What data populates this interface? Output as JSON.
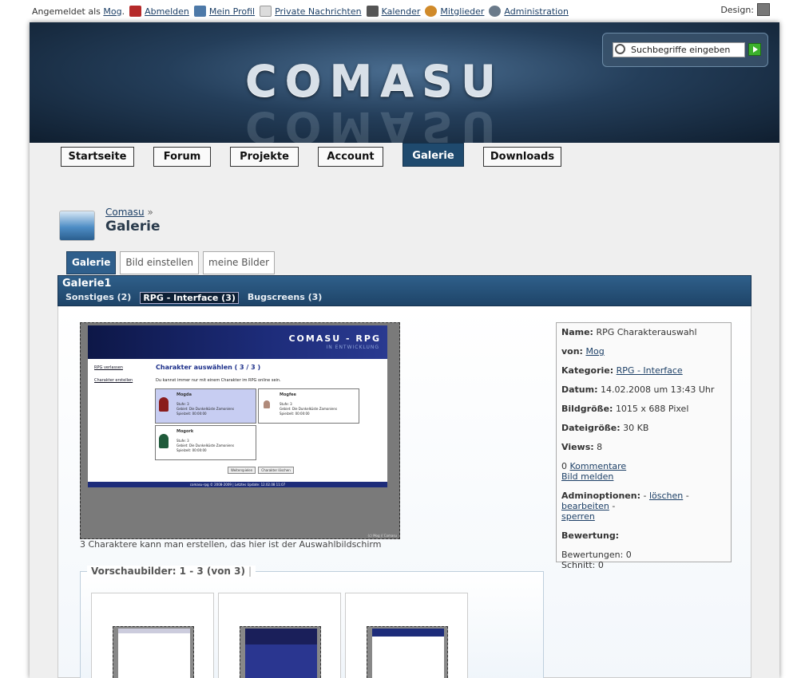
{
  "topbar": {
    "logged_prefix": "Angemeldet als",
    "user": "Mog",
    "logged_suffix": ".",
    "items": [
      {
        "label": "Abmelden",
        "icon": "logout-icon",
        "color": "#b52a2a"
      },
      {
        "label": "Mein Profil",
        "icon": "profile-card-icon",
        "color": "#4d79a8"
      },
      {
        "label": "Private Nachrichten",
        "icon": "envelope-icon",
        "color": "#c9c9c9"
      },
      {
        "label": "Kalender",
        "icon": "calendar-icon",
        "color": "#555555"
      },
      {
        "label": "Mitglieder",
        "icon": "members-icon",
        "color": "#d08a2a"
      },
      {
        "label": "Administration",
        "icon": "gear-icon",
        "color": "#6a7a8a"
      }
    ],
    "design_label": "Design:"
  },
  "header": {
    "logo": "COMASU",
    "search_placeholder": "Suchbegriffe eingeben"
  },
  "nav": [
    {
      "label": "Startseite",
      "active": false
    },
    {
      "label": "Forum",
      "active": false
    },
    {
      "label": "Projekte",
      "active": false
    },
    {
      "label": "Account",
      "active": false
    },
    {
      "label": "Galerie",
      "active": true
    },
    {
      "label": "Downloads",
      "active": false
    }
  ],
  "breadcrumb": {
    "link": "Comasu",
    "sep": "»",
    "title": "Galerie"
  },
  "tabs": [
    {
      "label": "Galerie",
      "active": true
    },
    {
      "label": "Bild einstellen",
      "active": false
    },
    {
      "label": "meine Bilder",
      "active": false
    }
  ],
  "gallery": {
    "title": "Galerie1",
    "categories": [
      {
        "label": "Sonstiges (2)",
        "selected": false
      },
      {
        "label": "RPG - Interface (3)",
        "selected": true
      },
      {
        "label": "Bugscreens (3)",
        "selected": false
      }
    ]
  },
  "screenshot": {
    "header_title": "COMASU - RPG",
    "header_sub": "IN ENTWICKLUNG",
    "side_links": [
      "RPG verlassen",
      "Charakter erstellen"
    ],
    "heading": "Charakter auswählen ( 3 / 3 )",
    "subtext": "Du kannst immer nur mit einem Charakter im RPG online sein.",
    "characters": [
      {
        "name": "Mogda",
        "stufe": "Stufe: 3",
        "gebiet": "Gebiet: Die Dunkelküste Zamoniens",
        "spielzeit": "Spielzeit: 00:00:00"
      },
      {
        "name": "Mogfee",
        "stufe": "Stufe: 3",
        "gebiet": "Gebiet: Die Dunkelküste Zamoniens",
        "spielzeit": "Spielzeit: 00:00:00"
      },
      {
        "name": "Mogork",
        "stufe": "Stufe: 3",
        "gebiet": "Gebiet: Die Dunkelküste Zamoniens",
        "spielzeit": "Spielzeit: 00:00:00"
      }
    ],
    "buttons": [
      "Weiterspielen",
      "Charakter löschen"
    ],
    "footer": "comasu-rpg © 2008-2009 | Letztes Update: 12.02.08 11:07",
    "corner": "(c) Mog // Comasu"
  },
  "caption": "3 Charaktere kann man erstellen, das hier ist der Auswahlbildschirm",
  "info": {
    "name_label": "Name:",
    "name": "RPG Charakterauswahl",
    "von_label": "von:",
    "von": "Mog",
    "kategorie_label": "Kategorie:",
    "kategorie": "RPG - Interface",
    "datum_label": "Datum:",
    "datum": "14.02.2008 um 13:43 Uhr",
    "groesse_label": "Bildgröße:",
    "groesse": "1015 x 688 Pixel",
    "datei_label": "Dateigröße:",
    "datei": "30 KB",
    "views_label": "Views:",
    "views": "8",
    "komm_count": "0",
    "komm_link": "Kommentare",
    "melden": "Bild melden",
    "admin_label": "Adminoptionen:",
    "admin_dash": "-",
    "admin_loeschen": "löschen",
    "admin_bearbeiten": "bearbeiten",
    "admin_sperren": "sperren",
    "bewertung_label": "Bewertung:",
    "bewertungen": "Bewertungen: 0",
    "schnitt": "Schnitt: 0"
  },
  "preview": {
    "legend": "Vorschaubilder: 1 - 3 (von 3)",
    "bar": "|"
  }
}
